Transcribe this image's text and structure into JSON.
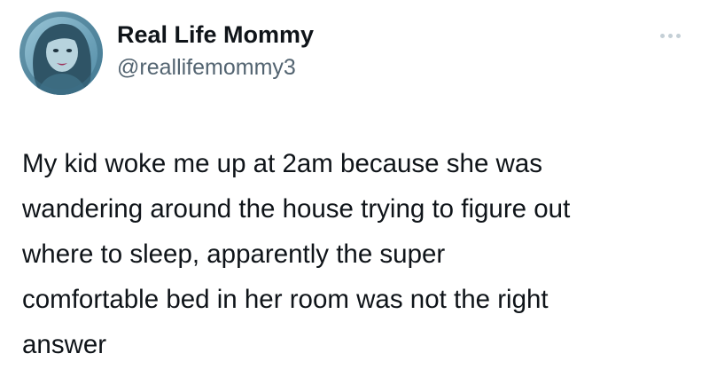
{
  "author": {
    "display_name": "Real Life Mommy",
    "handle": "@reallifemommy3",
    "avatar_icon": "profile-avatar-icon",
    "avatar_ring_text": "@reallifemommy3"
  },
  "menu": {
    "icon": "more-options-icon"
  },
  "tweet": {
    "lines": [
      "My kid woke me up at 2am because she was",
      "wandering around the house trying to figure out",
      "where to sleep, apparently the super",
      "comfortable bed in her room was not the right",
      "answer"
    ]
  },
  "colors": {
    "text_primary": "#0f1419",
    "text_secondary": "#536471",
    "menu_dots": "#c4cfd6",
    "avatar_bg": "#6fa8c0"
  }
}
